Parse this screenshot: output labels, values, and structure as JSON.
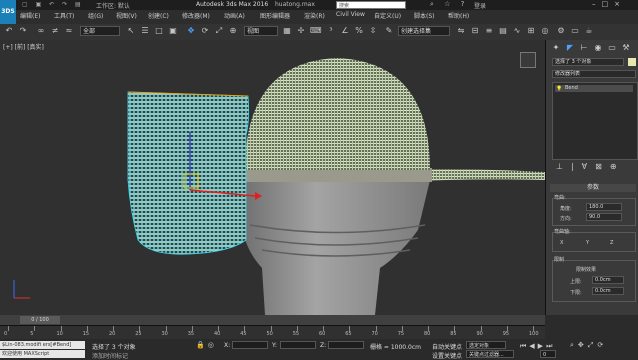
{
  "title_bar": {
    "logo_text": "3DS",
    "workspace_label": "工作区: 默认",
    "app_title": "Autodesk 3ds Max 2016",
    "file_tab": "huatong.max",
    "search_placeholder": "搜索",
    "login_label": "登录"
  },
  "menu": {
    "items": [
      "编辑(E)",
      "工具(T)",
      "组(G)",
      "视图(V)",
      "创建(C)",
      "修改器(M)",
      "动画(A)",
      "图形编辑器",
      "渲染(R)",
      "Civil View",
      "自定义(U)",
      "脚本(S)",
      "帮助(H)"
    ]
  },
  "toolbar": {
    "selection_filter": "全部",
    "ref_coord": "视图",
    "named_selection": "创建选择集"
  },
  "viewport": {
    "label": "[+] [前] [真实]"
  },
  "command_panel": {
    "selection_info": "选择了 3 个对象",
    "modifier_list": "修改器列表",
    "stack_item": "Bend",
    "rollout_title": "参数",
    "bend_group": "弯曲:",
    "angle_label": "角度:",
    "angle_value": "180.0",
    "direction_label": "方向:",
    "direction_value": "90.0",
    "axis_group": "弯曲轴:",
    "axis_x": "X",
    "axis_y": "Y",
    "axis_z": "Z",
    "limits_group": "限制",
    "limit_effect": "限制效果",
    "upper_label": "上限:",
    "upper_value": "0.0cm",
    "lower_label": "下限:",
    "lower_value": "0.0cm"
  },
  "timeline": {
    "frame_display": "0 / 100",
    "ticks": [
      "0",
      "5",
      "10",
      "15",
      "20",
      "25",
      "30",
      "35",
      "40",
      "45",
      "50",
      "55",
      "60",
      "65",
      "70",
      "75",
      "80",
      "85",
      "90",
      "95",
      "100"
    ]
  },
  "status_bar": {
    "maxscript_line1": "$Lin-083.modifi ers[#Bend]",
    "maxscript_line2": "欢迎使用 MAXScript",
    "selection_status": "选择了 3 个对象",
    "x_label": "X:",
    "y_label": "Y:",
    "z_label": "Z:",
    "grid_label": "栅格 = 1000.0cm",
    "autokey_label": "自动关键点",
    "selected_obj": "选定对象",
    "add_time_tag": "添加时间标记",
    "set_key_label": "设置关键点",
    "key_filters": "关键点过滤器...",
    "frame_value": "0"
  },
  "colors": {
    "accent": "#4ea2ff",
    "mesh_green": "#d7e7c3",
    "mesh_blue": "#3fd6f0",
    "gizmo_orange": "#e6a11a",
    "body_gray": "#8e8e8e"
  }
}
